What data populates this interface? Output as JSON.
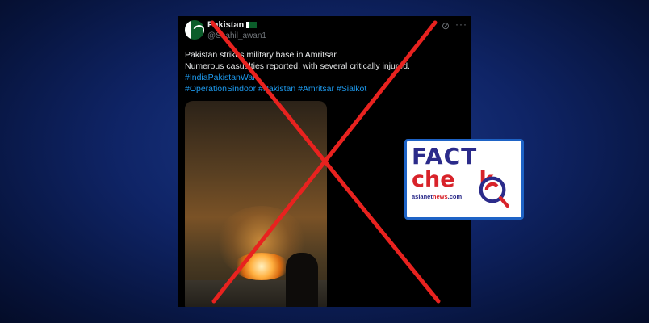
{
  "tweet": {
    "display_name": "Pakistan",
    "handle": "@Shahil_awan1",
    "line1": "Pakistan strikes military base in Amritsar.",
    "line2": "Numerous casualties reported, with several critically injured.",
    "hashtags_line1": "#IndiaPakistanWar",
    "hashtags_line2": "#OperationSindoor #Pakistan #Amritsar #Sialkot",
    "grok_icon": "grok-icon",
    "more_icon": "more-icon",
    "more_glyph": "···"
  },
  "overlay": {
    "cross_color": "#e8221f"
  },
  "badge": {
    "fact": "FACT",
    "check": "che",
    "check_end": "k",
    "brand_a": "asianet",
    "brand_b": "news",
    "brand_c": ".com"
  }
}
